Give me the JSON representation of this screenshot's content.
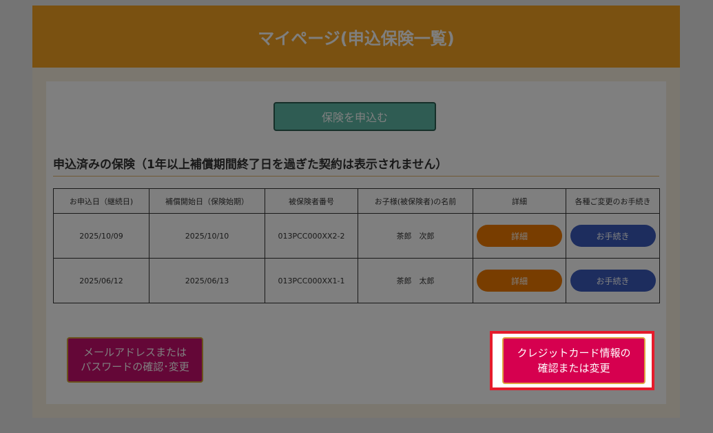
{
  "header": {
    "title": "マイページ(申込保険一覧)"
  },
  "apply_button": {
    "label": "保険を申込む"
  },
  "section": {
    "title": "申込済みの保険（1年以上補償期間終了日を過ぎた契約は表示されません）"
  },
  "table": {
    "headers": [
      "お申込日（継続日)",
      "補償開始日（保険始期）",
      "被保険者番号",
      "お子様(被保険者)の名前",
      "詳細",
      "各種ご変更のお手続き"
    ],
    "rows": [
      {
        "applied": "2025/10/09",
        "start": "2025/10/10",
        "number": "013PCC000XX2-2",
        "name": "茶郎　次郎",
        "detail": "詳細",
        "procedure": "お手続き"
      },
      {
        "applied": "2025/06/12",
        "start": "2025/06/13",
        "number": "013PCC000XX1-1",
        "name": "茶郎　太郎",
        "detail": "詳細",
        "procedure": "お手続き"
      }
    ]
  },
  "mail_button": {
    "line1": "メールアドレスまたは",
    "line2": "パスワードの確認･変更"
  },
  "card_button": {
    "line1": "クレジットカード情報の",
    "line2": "確認または変更"
  },
  "colors": {
    "header": "#f4a322",
    "apply_button": "#5fb8a6",
    "detail_pill": "#f07a00",
    "procedure_pill": "#3a5bbd",
    "mail_button": "#c90f6f",
    "card_button": "#d6004f",
    "highlight": "#e51b2b"
  }
}
